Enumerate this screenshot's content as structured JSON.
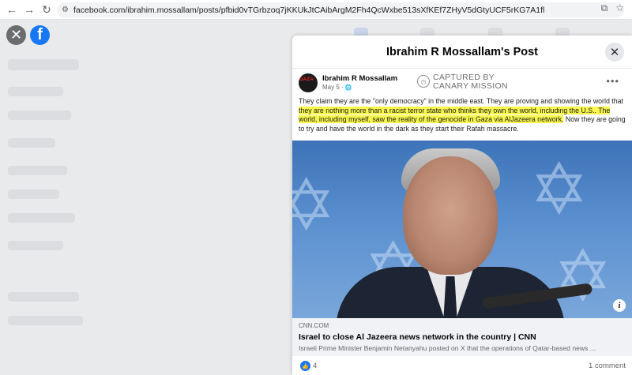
{
  "browser": {
    "back_icon": "←",
    "forward_icon": "→",
    "reload_icon": "↻",
    "url": "facebook.com/ibrahim.mossallam/posts/pfbid0vTGrbzoq7jKKUkJtCAibArgM2Fh4QcWxbe513sXfKEf7ZHyV5dGtyUCF5rKG7A1fl"
  },
  "page": {
    "close_glyph": "✕",
    "logo_glyph": "f"
  },
  "modal": {
    "title": "Ibrahim R Mossallam's Post",
    "close_glyph": "✕"
  },
  "post": {
    "avatar_text": "GAZA",
    "author": "Ibrahim R Mossallam",
    "date": "May 5",
    "stamp_line1": "CAPTURED BY",
    "stamp_line2": "CANARY MISSION",
    "more": "•••",
    "text_plain_1": "They claim they are the \"only democracy\" in the middle east. They are proving and showing the world that ",
    "text_highlight": "they are nothing more than a racist terror state who thinks they own the world, including the U.S.. The world, including myself, saw the reality of the genocide in Gaza via AlJazeera network.",
    "text_plain_2": " Now they are going to try and have the world in the dark as they start their Rafah massacre."
  },
  "link": {
    "domain": "CNN.COM",
    "title": "Israel to close Al Jazeera news network in the country | CNN",
    "description": "Israeli Prime Minister Benjamin Netanyahu posted on X that the operations of Qatar-based news ..."
  },
  "footer": {
    "like_count": "4",
    "comments": "1 comment"
  },
  "colors": {
    "accent": "#1877f2",
    "highlight": "#f9f74c"
  }
}
